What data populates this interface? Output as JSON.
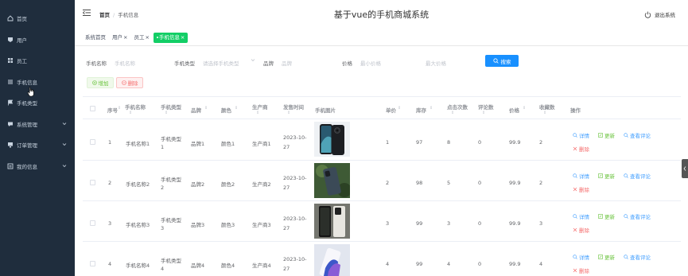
{
  "sidebar": {
    "items": [
      {
        "label": "首页",
        "icon": "home-icon"
      },
      {
        "label": "用户",
        "icon": "user-icon"
      },
      {
        "label": "员工",
        "icon": "grid-icon"
      },
      {
        "label": "手机信息",
        "icon": "list-icon"
      },
      {
        "label": "手机类型",
        "icon": "flag-icon"
      },
      {
        "label": "系统管理",
        "icon": "chat-icon"
      },
      {
        "label": "订单管理",
        "icon": "monitor-icon"
      },
      {
        "label": "我的信息",
        "icon": "document-icon"
      }
    ]
  },
  "header": {
    "breadcrumb_home": "首页",
    "breadcrumb_sep": "/",
    "breadcrumb_current": "手机信息",
    "title": "基于vue的手机商城系统",
    "logout": "退出系统"
  },
  "tabs": [
    {
      "label": "系统首页",
      "close": ""
    },
    {
      "label": "用户",
      "close": "×"
    },
    {
      "label": "员工",
      "close": "×"
    },
    {
      "label": "手机信息",
      "close": "×"
    }
  ],
  "search": {
    "name_label": "手机名称",
    "name_placeholder": "手机名称",
    "type_label": "手机类型",
    "type_placeholder": "请选择手机类型",
    "brand_label": "品牌",
    "brand_placeholder": "品牌",
    "price_label": "价格",
    "price_min_placeholder": "最小价格",
    "price_max_placeholder": "最大价格",
    "button": "搜索"
  },
  "actions": {
    "add": "增加",
    "delete": "删除"
  },
  "table": {
    "headers": {
      "index": "序号",
      "name": "手机名称",
      "type": "手机类型",
      "brand": "品牌",
      "color": "颜色",
      "maker": "生产商",
      "date": "发售时间",
      "image": "手机图片",
      "price_unit": "单价",
      "stock": "库存",
      "clicks": "点击次数",
      "comments": "评论数",
      "price": "价格",
      "favorites": "收藏数",
      "ops": "操作"
    },
    "sort_glyph": "⇕",
    "rows": [
      {
        "index": "1",
        "name": "手机名称1",
        "type1": "手机类型",
        "type2": "1",
        "brand": "品牌1",
        "color": "颜色1",
        "maker": "生产商1",
        "date1": "2023-10-",
        "date2": "27",
        "unit": "1",
        "stock": "97",
        "clicks": "8",
        "comments": "0",
        "price": "99.9",
        "favorites": "2"
      },
      {
        "index": "2",
        "name": "手机名称2",
        "type1": "手机类型",
        "type2": "2",
        "brand": "品牌2",
        "color": "颜色2",
        "maker": "生产商2",
        "date1": "2023-10-",
        "date2": "27",
        "unit": "2",
        "stock": "98",
        "clicks": "5",
        "comments": "0",
        "price": "99.9",
        "favorites": "2"
      },
      {
        "index": "3",
        "name": "手机名称3",
        "type1": "手机类型",
        "type2": "3",
        "brand": "品牌3",
        "color": "颜色3",
        "maker": "生产商3",
        "date1": "2023-10-",
        "date2": "27",
        "unit": "3",
        "stock": "99",
        "clicks": "3",
        "comments": "0",
        "price": "99.9",
        "favorites": "3"
      },
      {
        "index": "4",
        "name": "手机名称4",
        "type1": "手机类型",
        "type2": "4",
        "brand": "品牌4",
        "color": "颜色4",
        "maker": "生产商4",
        "date1": "2023-10-",
        "date2": "27",
        "unit": "4",
        "stock": "99",
        "clicks": "4",
        "comments": "0",
        "price": "99.9",
        "favorites": "4"
      }
    ],
    "op_labels": {
      "detail": "详情",
      "update": "更新",
      "view_comments": "查看评论",
      "delete": "删除"
    }
  },
  "colors": {
    "sidebar_bg": "#1f2d3d",
    "accent": "#1890ff",
    "tab_active": "#13ce66",
    "success": "#67c23a",
    "danger": "#f56c6c"
  }
}
